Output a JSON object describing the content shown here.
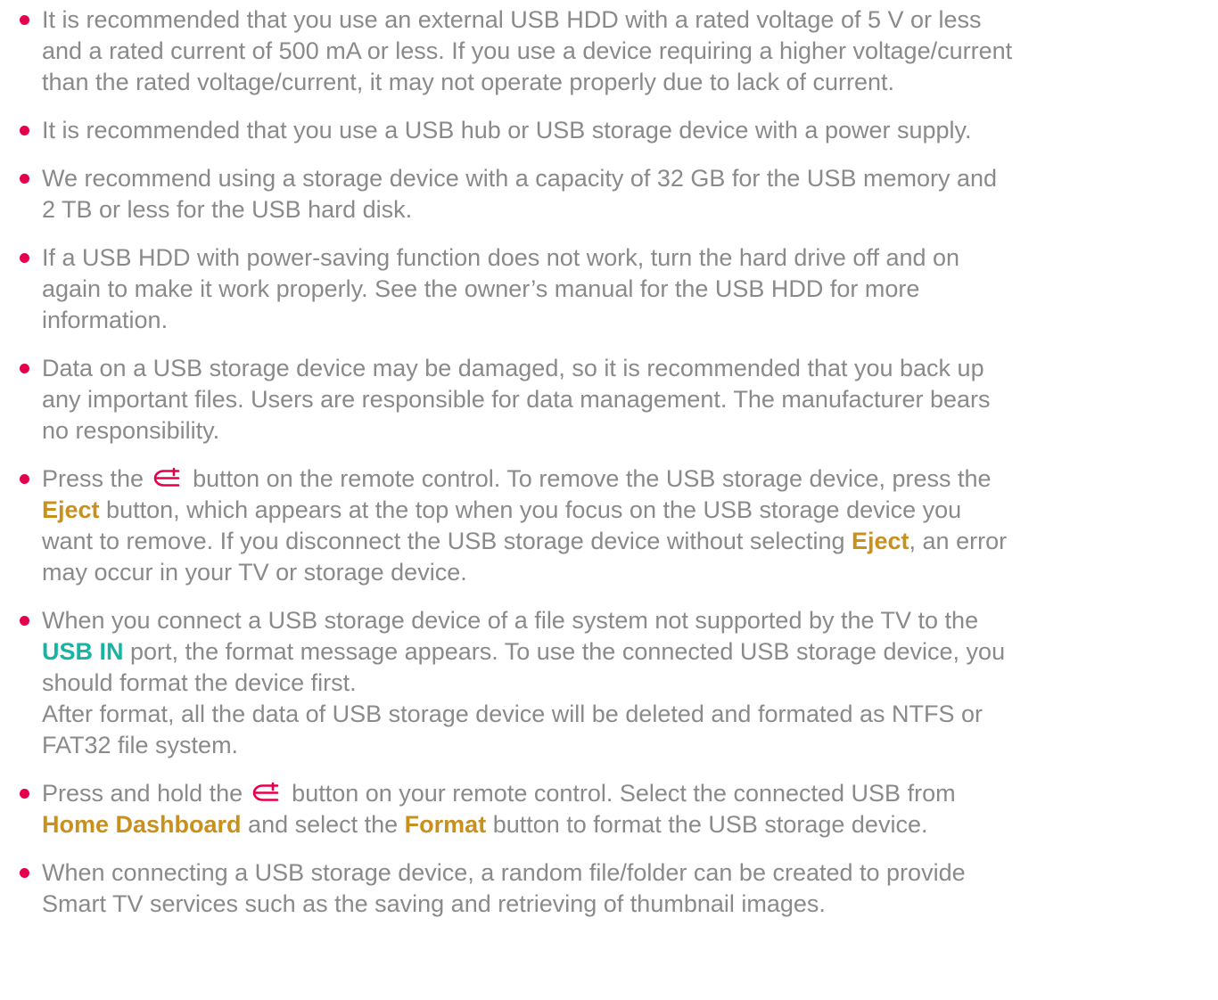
{
  "colors": {
    "bullet": "#e5004f",
    "text": "#8a8a8a",
    "keyword": "#c8901c",
    "port_keyword": "#19b3a4",
    "icon": "#e5004f"
  },
  "icons": {
    "home": "home-button-icon"
  },
  "items": [
    {
      "lines": [
        "It is recommended that you use an external USB HDD with a rated voltage of 5 V or less",
        "and a rated current of 500 mA or less. If you use a device requiring a higher voltage/current",
        "than the rated voltage/current, it may not operate properly due to lack of current."
      ]
    },
    {
      "lines": [
        "It is recommended that you use a USB hub or USB storage device with a power supply."
      ]
    },
    {
      "lines": [
        "We recommend using a storage device with a capacity of 32 GB for the USB memory and",
        "2 TB or less for the USB hard disk."
      ]
    },
    {
      "lines": [
        "If a USB HDD with power-saving function does not work, turn the hard drive off and on",
        "again to make it work properly. See the owner’s manual for the USB HDD for more",
        "information."
      ]
    },
    {
      "lines": [
        "Data on a USB storage device may be damaged, so it is recommended that you back up",
        "any important files. Users are responsible for data management. The manufacturer bears",
        "no responsibility."
      ]
    },
    {
      "l1a": "Press the",
      "l1b": " button on the remote control. To remove the USB storage device, press the",
      "eject": "Eject",
      "l2b": " button, which appears at the top when you focus on the USB storage device you",
      "l3a": "want to remove. If you disconnect the USB storage device without selecting ",
      "l3c": ", an error",
      "l4": "may occur in your TV or storage device."
    },
    {
      "l1": "When you connect a USB storage device of a file system not supported by the TV to the",
      "port": "USB IN",
      "l2b": " port, the format message appears. To use the connected USB storage device, you",
      "l3": "should format the device first.",
      "l4": "After format, all the data of USB storage device will be deleted and formated as NTFS or",
      "l5": "FAT32 file system."
    },
    {
      "l1a": "Press and hold the",
      "l1b": " button on your remote control. Select the connected USB from",
      "dashboard": "Home Dashboard",
      "l2b": " and select the ",
      "format": "Format",
      "l2d": " button to format the USB storage device."
    },
    {
      "lines": [
        "When connecting a USB storage device, a random file/folder can be created to provide",
        "Smart TV services such as the saving and retrieving of thumbnail images."
      ]
    }
  ]
}
